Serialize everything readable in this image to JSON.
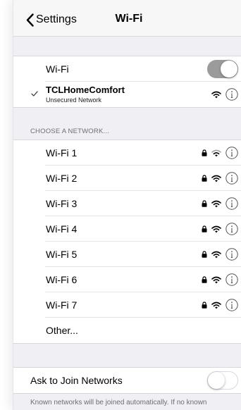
{
  "navbar": {
    "back_label": "Settings",
    "title": "Wi-Fi"
  },
  "wifi_toggle": {
    "label": "Wi-Fi",
    "state": "on"
  },
  "current_network": {
    "name": "TCLHomeComfort",
    "subtitle": "Unsecured Network",
    "connected": true,
    "icons": [
      "checkmark-icon",
      "wifi-icon",
      "info-icon"
    ]
  },
  "choose_network": {
    "header": "CHOOSE A NETWORK...",
    "networks": [
      {
        "name": "Wi-Fi 1",
        "secured": true
      },
      {
        "name": "Wi-Fi 2",
        "secured": true
      },
      {
        "name": "Wi-Fi 3",
        "secured": true
      },
      {
        "name": "Wi-Fi 4",
        "secured": true
      },
      {
        "name": "Wi-Fi 5",
        "secured": true
      },
      {
        "name": "Wi-Fi 6",
        "secured": true
      },
      {
        "name": "Wi-Fi 7",
        "secured": true
      }
    ],
    "other_label": "Other..."
  },
  "ask_to_join": {
    "label": "Ask to Join Networks",
    "state": "off",
    "footer": "Known networks will be joined automatically. If no known"
  },
  "colors": {
    "grouped_background": "#efeff4",
    "toggle_on": "#9b9b9b",
    "separator": "#d8d8dc",
    "footer_text": "#6d6d72"
  }
}
